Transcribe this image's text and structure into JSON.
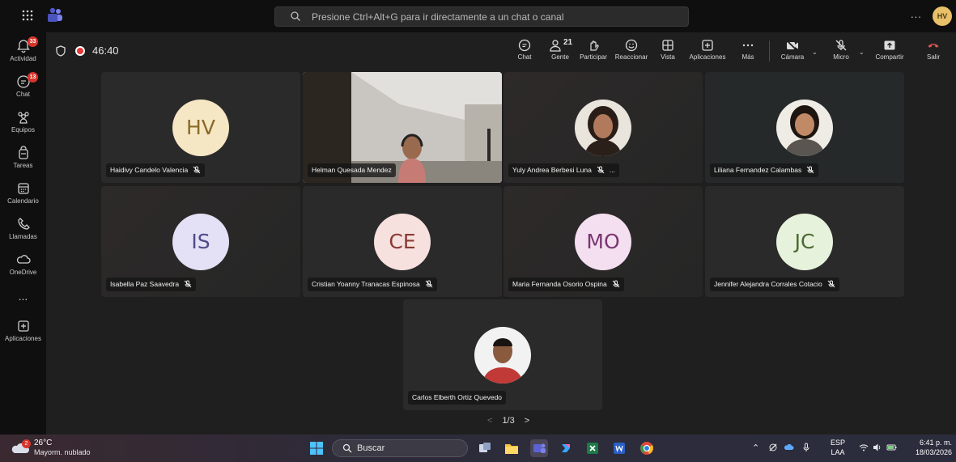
{
  "topbar": {
    "search_placeholder": "Presione Ctrl+Alt+G para ir directamente a un chat o canal",
    "more": "...",
    "user_initials": "HV"
  },
  "rail": {
    "items": [
      {
        "label": "Actividad",
        "badge": "33"
      },
      {
        "label": "Chat",
        "badge": "13"
      },
      {
        "label": "Equipos"
      },
      {
        "label": "Tareas"
      },
      {
        "label": "Calendario"
      },
      {
        "label": "Llamadas"
      },
      {
        "label": "OneDrive"
      },
      {
        "label": "..."
      },
      {
        "label": "Aplicaciones"
      }
    ]
  },
  "meeting": {
    "timer": "46:40",
    "participants_count": "21",
    "toolbar": {
      "chat": "Chat",
      "people": "Gente",
      "raise": "Participar",
      "react": "Reaccionar",
      "view": "Vista",
      "apps": "Aplicaciones",
      "more": "Más",
      "camera": "Cámara",
      "mic": "Micro",
      "share": "Compartir",
      "leave": "Salir"
    },
    "tiles": [
      {
        "name": "Haidivy Candelo Valencia",
        "initials": "HV"
      },
      {
        "name": "Helman Quesada Mendez"
      },
      {
        "name": "Yuly Andrea Berbesi Luna",
        "more": "..."
      },
      {
        "name": "Liliana Fernandez Calambas"
      },
      {
        "name": "Isabella Paz Saavedra",
        "initials": "IS"
      },
      {
        "name": "Cristian Yoanny Tranacas Espinosa",
        "initials": "CE"
      },
      {
        "name": "Maria Fernanda Osorio Ospina",
        "initials": "MO"
      },
      {
        "name": "Jennifer Alejandra Corrales Cotacio",
        "initials": "JC"
      },
      {
        "name": "Carlos Elberth Ortiz Quevedo"
      }
    ],
    "pager": {
      "prev": "<",
      "label": "1/3",
      "next": ">"
    }
  },
  "taskbar": {
    "weather_badge": "2",
    "temp": "26°C",
    "desc": "Mayorm. nublado",
    "search": "Buscar",
    "lang_1": "ESP",
    "lang_2": "LAA",
    "time": "6:41 p. m.",
    "date": "18/03/2026"
  },
  "colors": {
    "accent": "#8a8ef0",
    "hv": "#f6e7c4",
    "is": "#e4e1f6",
    "ce": "#f7e1df",
    "mo": "#f4dff0",
    "jc": "#e7f2dc",
    "leave": "#e5574e"
  }
}
